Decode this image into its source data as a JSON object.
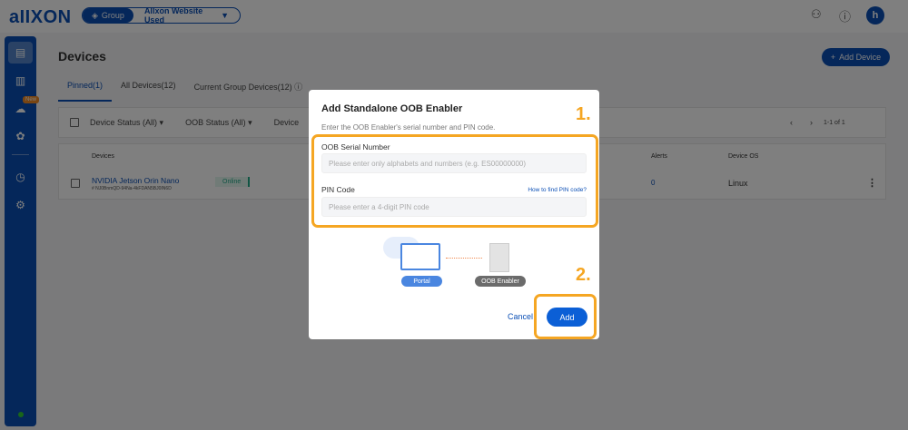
{
  "header": {
    "logo": "aIIXON",
    "group_label": "Group",
    "group_value": "Allxon Website Used",
    "avatar": "h",
    "icons": [
      "user-add-icon",
      "info-icon"
    ]
  },
  "sidebar": {
    "new_badge": "New",
    "items": [
      "devices-icon",
      "analytics-icon",
      "cloud-icon",
      "plugin-icon",
      "history-icon",
      "settings-icon"
    ]
  },
  "page": {
    "title": "Devices",
    "add_device": "Add Device",
    "tabs": [
      "Pinned(1)",
      "All Devices(12)",
      "Current Group Devices(12)"
    ],
    "filters": [
      "Device Status (All)",
      "OOB Status (All)",
      "Device"
    ],
    "pagination": "1-1 of 1",
    "columns": {
      "devices": "Devices",
      "alerts": "Alerts",
      "os": "Device OS"
    },
    "row": {
      "name": "NVIDIA Jetson Orin Nano",
      "serial": "# NJ0BnmQD-94Na-4kFDAN5BJ0IN6D",
      "status": "Online",
      "alerts": "0",
      "os": "Linux"
    }
  },
  "modal": {
    "title": "Add Standalone OOB Enabler",
    "subtitle": "Enter the OOB Enabler's serial number and PIN code.",
    "serial_label": "OOB Serial Number",
    "serial_placeholder": "Please enter only alphabets and numbers (e.g. ES00000000)",
    "pin_label": "PIN Code",
    "pin_link": "How to find PIN code?",
    "pin_placeholder": "Please enter a 4-digit PIN code",
    "portal_label": "Portal",
    "enabler_label": "OOB Enabler",
    "cancel": "Cancel",
    "add": "Add",
    "step1": "1.",
    "step2": "2.",
    "highlight_color": "#f5a623"
  }
}
